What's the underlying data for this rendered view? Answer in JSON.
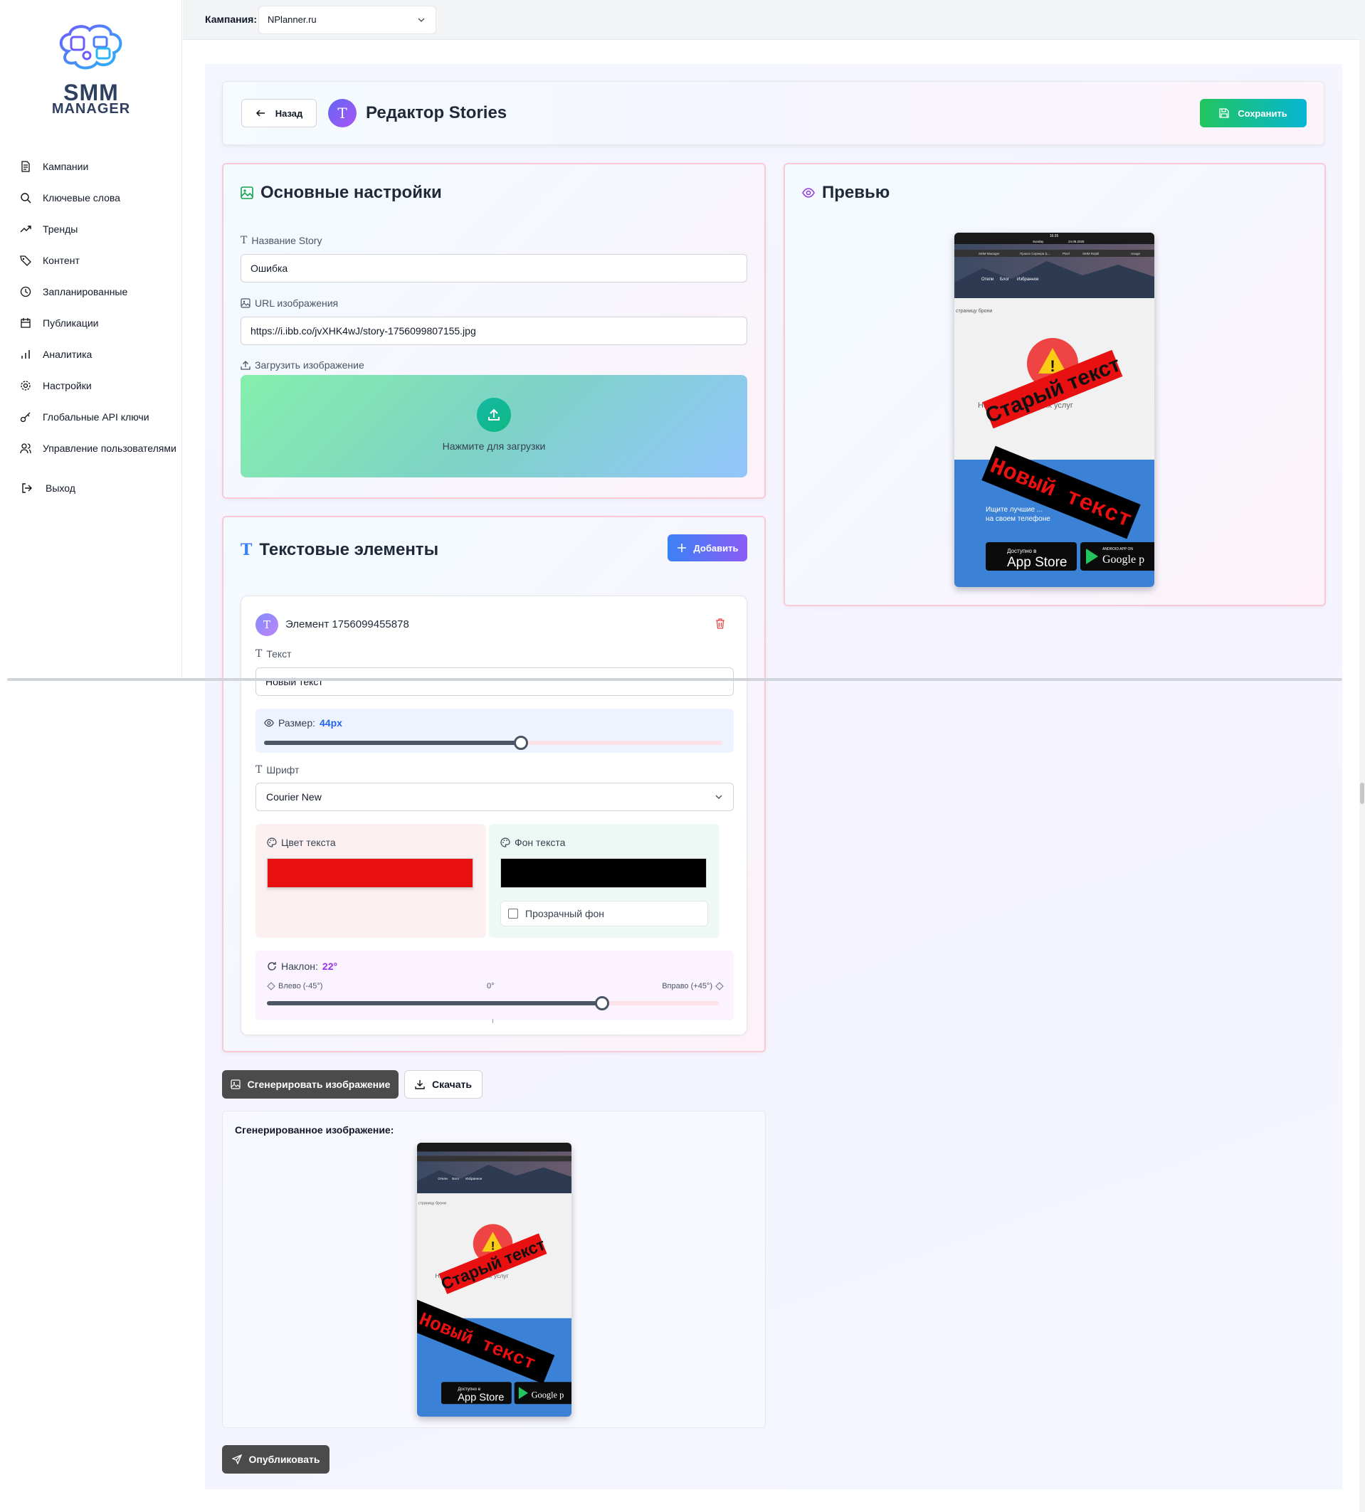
{
  "app": {
    "logo_title": "SMM",
    "logo_subtitle": "MANAGER"
  },
  "sidebar": {
    "items": [
      {
        "label": "Кампании",
        "icon": "document-icon"
      },
      {
        "label": "Ключевые слова",
        "icon": "search-icon"
      },
      {
        "label": "Тренды",
        "icon": "trending-up-icon"
      },
      {
        "label": "Контент",
        "icon": "tag-icon"
      },
      {
        "label": "Запланированные",
        "icon": "clock-icon"
      },
      {
        "label": "Публикации",
        "icon": "calendar-icon"
      },
      {
        "label": "Аналитика",
        "icon": "bar-chart-icon"
      },
      {
        "label": "Настройки",
        "icon": "gear-icon"
      },
      {
        "label": "Глобальные API ключи",
        "icon": "key-icon"
      },
      {
        "label": "Управление пользователями",
        "icon": "users-icon"
      }
    ],
    "logout": "Выход"
  },
  "topbar": {
    "campaign_label": "Кампания:",
    "campaign_value": "NPlanner.ru"
  },
  "header": {
    "back_label": "Назад",
    "avatar_letter": "T",
    "title": "Редактор Stories",
    "save_label": "Сохранить"
  },
  "basic": {
    "title": "Основные настройки",
    "name_label": "Название Story",
    "name_value": "Ошибка",
    "url_label": "URL изображения",
    "url_value": "https://i.ibb.co/jvXHK4wJ/story-1756099807155.jpg",
    "upload_label": "Загрузить изображение",
    "upload_text": "Нажмите для загрузки"
  },
  "text_elements": {
    "title": "Текстовые элементы",
    "add_label": "Добавить",
    "element": {
      "avatar_letter": "T",
      "title": "Элемент 1756099455878",
      "text_label": "Текст",
      "text_value": "Новый текст",
      "size_label": "Размер:",
      "size_value": "44px",
      "size_fraction": 0.56,
      "font_label": "Шрифт",
      "font_value": "Courier New",
      "text_color_label": "Цвет текста",
      "text_color": "#e81010",
      "bg_color_label": "Фон текста",
      "bg_color": "#000000",
      "transparent_label": "Прозрачный фон",
      "transparent_checked": false,
      "tilt_label": "Наклон:",
      "tilt_value": "22°",
      "tilt_fraction": 0.74,
      "tilt_left": "Влево (-45°)",
      "tilt_center": "0°",
      "tilt_right": "Вправо (+45°)"
    }
  },
  "preview": {
    "title": "Превью",
    "overlay_old": "Старый текст",
    "overlay_new": "Новый текст",
    "status_time": "16:35",
    "status_day": "Sunday",
    "status_date": "24.08.2025",
    "tabs": [
      "SMM Manager",
      "Проксе Сервера (L...",
      "Pixel",
      "SMM Reptil",
      "Usage"
    ],
    "nav": [
      "Отели",
      "Блог",
      "Избранное"
    ],
    "crumb": "страницу брони",
    "msg": "Нет доп...нительных услуг",
    "banner_line1": "Ищите лучшие ...",
    "banner_line2": "на своем телефоне",
    "appstore_small": "Доступно в",
    "appstore_big": "App Store",
    "google_small": "ANDROID APP ON",
    "google_big": "Google p"
  },
  "actions": {
    "generate_label": "Сгенерировать изображение",
    "download_label": "Скачать",
    "publish_label": "Опубликовать"
  },
  "generated": {
    "label": "Сгенерированное изображение:"
  }
}
